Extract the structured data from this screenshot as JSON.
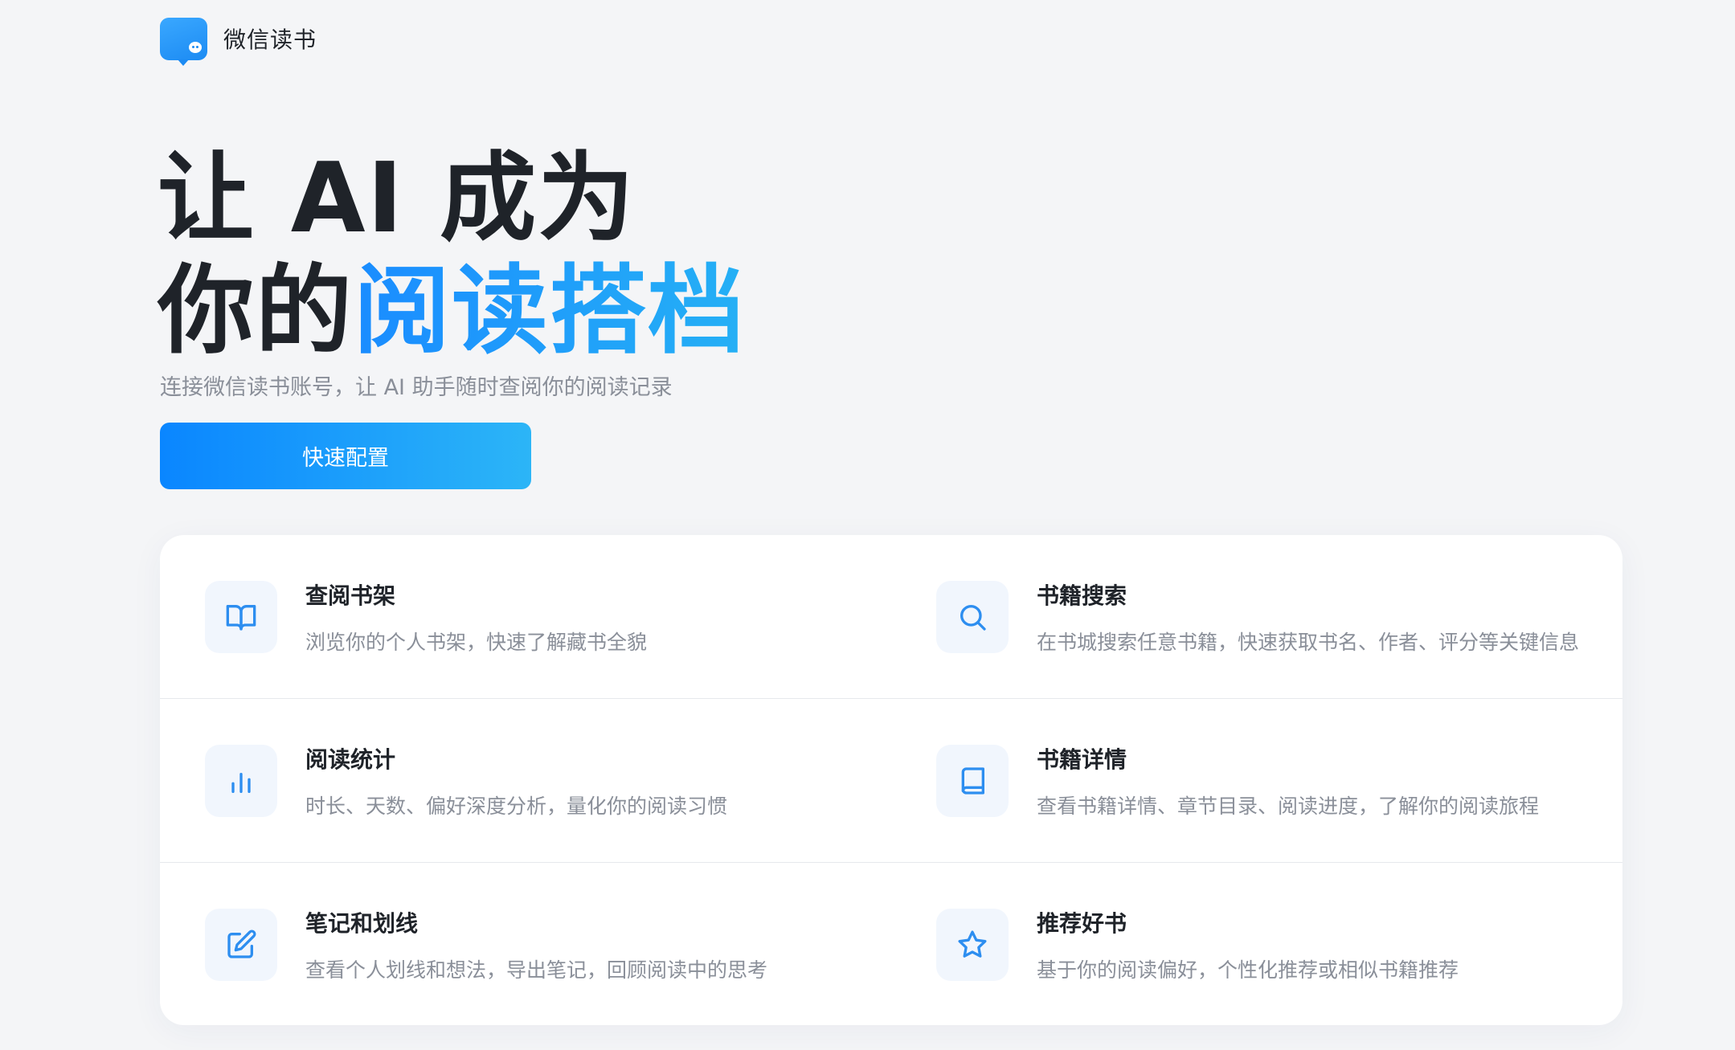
{
  "brand": {
    "name": "微信读书"
  },
  "hero": {
    "title_line1": "让 AI 成为",
    "title_line2_prefix": "你的",
    "title_line2_accent": "阅读搭档",
    "subtitle": "连接微信读书账号，让 AI 助手随时查阅你的阅读记录",
    "cta_label": "快速配置"
  },
  "colors": {
    "accent": "#1a8cff",
    "accent_light": "#25b0f5",
    "background": "#f4f5f7",
    "icon_bg": "#f1f6fd"
  },
  "features": {
    "items": [
      {
        "icon": "book-open-icon",
        "title": "查阅书架",
        "desc": "浏览你的个人书架，快速了解藏书全貌"
      },
      {
        "icon": "search-icon",
        "title": "书籍搜索",
        "desc": "在书城搜索任意书籍，快速获取书名、作者、评分等关键信息"
      },
      {
        "icon": "bar-chart-icon",
        "title": "阅读统计",
        "desc": "时长、天数、偏好深度分析，量化你的阅读习惯"
      },
      {
        "icon": "book-icon",
        "title": "书籍详情",
        "desc": "查看书籍详情、章节目录、阅读进度，了解你的阅读旅程"
      },
      {
        "icon": "edit-icon",
        "title": "笔记和划线",
        "desc": "查看个人划线和想法，导出笔记，回顾阅读中的思考"
      },
      {
        "icon": "star-icon",
        "title": "推荐好书",
        "desc": "基于你的阅读偏好，个性化推荐或相似书籍推荐"
      }
    ]
  }
}
